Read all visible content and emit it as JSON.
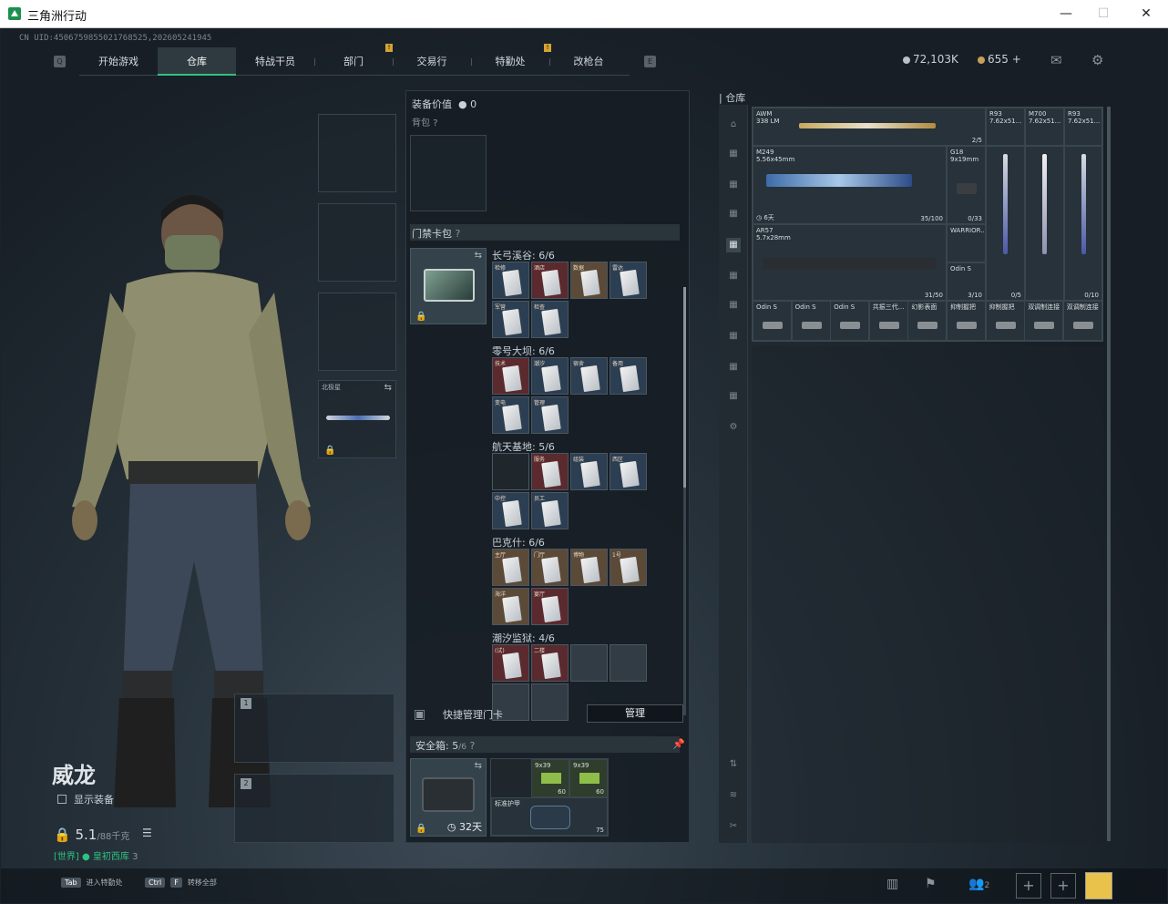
{
  "window": {
    "title": "三角洲行动",
    "min": "—",
    "max": "☐",
    "close": "✕"
  },
  "uid": "CN UID:4506759855021768525,202605241945",
  "nav": {
    "tabs": [
      "开始游戏",
      "仓库",
      "特战干员",
      "部门",
      "交易行",
      "特勤处",
      "改枪台"
    ],
    "active": "仓库",
    "badges_on": [
      "部门",
      "特勤处"
    ]
  },
  "currency": {
    "coins": "72,103K",
    "tickets": "655",
    "plus": "+",
    "coin_color": "#b9c0c6",
    "ticket_color": "#c99f59"
  },
  "icons": {
    "mail": "mail-icon",
    "settings": "gear-icon"
  },
  "character": {
    "name": "威龙",
    "show_equip": "显示装备",
    "weight_value": "5.1",
    "weight_max": "/88千克",
    "status_channel": "[世界]",
    "status_mode": "皇初西库",
    "status_count": "3"
  },
  "left_slots": {
    "weapon_label": "北极星",
    "slot1": "1",
    "slot2": "2"
  },
  "hints": [
    {
      "key": "Tab",
      "label": "进入特勤处"
    },
    {
      "key1": "Ctrl",
      "key2": "F",
      "label": "转移全部"
    }
  ],
  "mid": {
    "equip_value_label": "装备价值",
    "equip_value": "0",
    "backpack_label": "背包",
    "help": "?",
    "keycard_label": "门禁卡包",
    "groups": [
      {
        "title": "长弓溪谷: 6/6",
        "cards": [
          {
            "n": "检修",
            "c": "blue"
          },
          {
            "n": "酒店",
            "c": "red"
          },
          {
            "n": "数据",
            "c": "tan"
          },
          {
            "n": "雷达",
            "c": "blue"
          },
          {
            "n": "军营",
            "c": "blue"
          },
          {
            "n": "检查",
            "c": "blue"
          }
        ]
      },
      {
        "title": "零号大坝: 6/6",
        "cards": [
          {
            "n": "技术",
            "c": "red"
          },
          {
            "n": "潮汐",
            "c": "blue"
          },
          {
            "n": "宿舍",
            "c": "blue"
          },
          {
            "n": "备用",
            "c": "blue"
          },
          {
            "n": "变电",
            "c": "blue"
          },
          {
            "n": "管理",
            "c": "blue"
          }
        ]
      },
      {
        "title": "航天基地: 5/6",
        "cards": [
          {
            "n": "",
            "c": "empty"
          },
          {
            "n": "服务",
            "c": "red"
          },
          {
            "n": "组装",
            "c": "blue"
          },
          {
            "n": "西区",
            "c": "blue"
          },
          {
            "n": "中控",
            "c": "blue"
          },
          {
            "n": "员工",
            "c": "blue"
          }
        ]
      },
      {
        "title": "巴克什: 6/6",
        "cards": [
          {
            "n": "主厅",
            "c": "tan"
          },
          {
            "n": "门厅",
            "c": "tan"
          },
          {
            "n": "博物",
            "c": "tan"
          },
          {
            "n": "1号",
            "c": "tan"
          },
          {
            "n": "海洋",
            "c": "tan"
          },
          {
            "n": "宴厅",
            "c": "red"
          }
        ]
      },
      {
        "title": "潮汐监狱: 4/6",
        "cards": [
          {
            "n": "(试)",
            "c": "red"
          },
          {
            "n": "二楼",
            "c": "red"
          },
          {
            "n": "",
            "c": "gray"
          },
          {
            "n": "",
            "c": "gray"
          }
        ]
      }
    ],
    "quick_manage": "快捷管理门卡",
    "manage_btn": "管理",
    "safe_label": "安全箱:",
    "safe_count": "5",
    "safe_max": "/6",
    "safe_days": "32天",
    "safe_items": {
      "ammo1": "9x39",
      "ammo2": "9x39",
      "ammo1_count": "60",
      "ammo2_count": "60",
      "armor": "标准护甲",
      "armor_dur": "75"
    }
  },
  "warehouse": {
    "title": "仓库",
    "items": [
      {
        "id": "awm",
        "name": "AWM\n338 LM",
        "count": "2/5"
      },
      {
        "id": "r93a",
        "name": "R93\n7.62x51...",
        "count": ""
      },
      {
        "id": "m700",
        "name": "M700\n7.62x51...",
        "count": ""
      },
      {
        "id": "r93b",
        "name": "R93\n7.62x51...",
        "count": ""
      },
      {
        "id": "m249",
        "name": "M249\n5.56x45mm",
        "count": "35/100",
        "status": "6天"
      },
      {
        "id": "g18",
        "name": "G18\n9x19mm",
        "count": "0/33"
      },
      {
        "id": "warrior",
        "name": "WARRIOR...",
        "count": ""
      },
      {
        "id": "ar57",
        "name": "AR57\n5.7x28mm",
        "count": "31/50"
      },
      {
        "id": "odin_a",
        "name": "Odin S",
        "count": "3/10"
      },
      {
        "id": "r93a_cnt",
        "name": "",
        "count": "0/5"
      },
      {
        "id": "r93b_cnt",
        "name": "",
        "count": "0/10"
      }
    ],
    "bottom_row": [
      "Odin S",
      "Odin S",
      "Odin S",
      "共振三代...",
      "幻影表面",
      "抑制握把",
      "抑制握把",
      "双调制连接",
      "双调制连接"
    ]
  },
  "bottom": {
    "friends_count": "2",
    "plus": "+"
  }
}
